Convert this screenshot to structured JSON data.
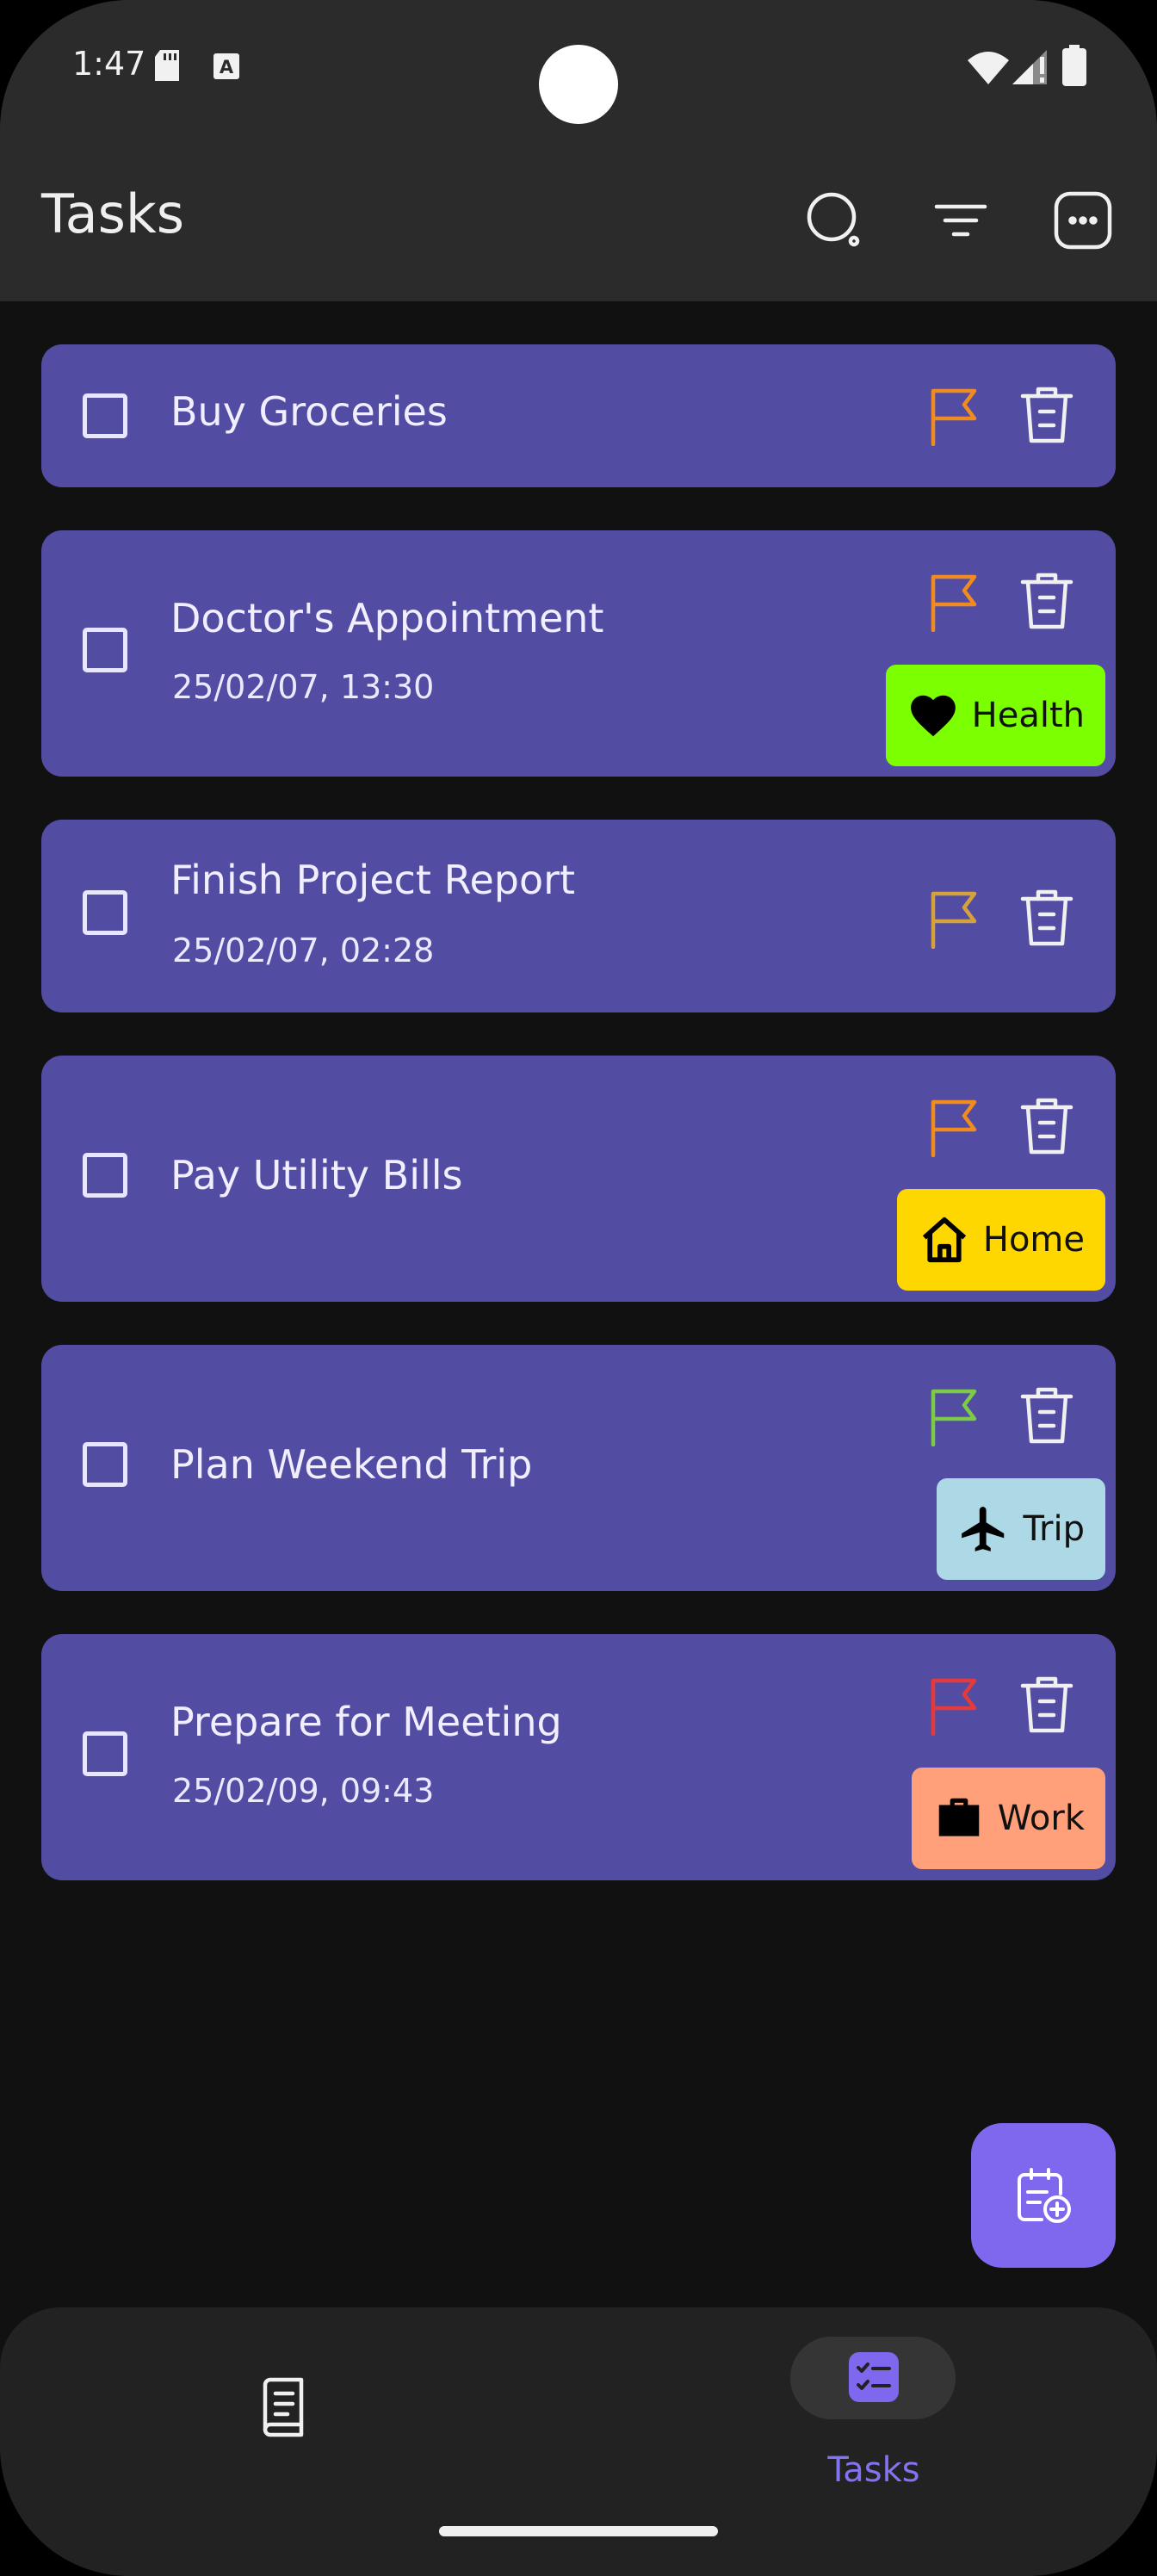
{
  "status_bar": {
    "time": "1:47"
  },
  "app_bar": {
    "title": "Tasks",
    "actions": [
      "search-icon",
      "filter-icon",
      "more-options-icon"
    ]
  },
  "tasks": [
    {
      "title": "Buy Groceries",
      "date": "",
      "flag_color": "#f08b1f",
      "tag": null
    },
    {
      "title": "Doctor's Appointment",
      "date": "25/02/07, 13:30",
      "flag_color": "#f08b1f",
      "tag": {
        "label": "Health",
        "icon": "heart-icon",
        "color": "#7cff00"
      }
    },
    {
      "title": "Finish Project Report",
      "date": "25/02/07, 02:28",
      "flag_color": "#d6a13b",
      "tag": null
    },
    {
      "title": "Pay Utility Bills",
      "date": "",
      "flag_color": "#f08b1f",
      "tag": {
        "label": "Home",
        "icon": "house-icon",
        "color": "#ffd700"
      }
    },
    {
      "title": "Plan Weekend Trip",
      "date": "",
      "flag_color": "#7ccb47",
      "tag": {
        "label": "Trip",
        "icon": "airplane-icon",
        "color": "#add8e6"
      }
    },
    {
      "title": "Prepare for Meeting",
      "date": "25/02/09, 09:43",
      "flag_color": "#e33b3b",
      "tag": {
        "label": "Work",
        "icon": "briefcase-icon",
        "color": "#ffa07a"
      }
    }
  ],
  "fab": {
    "icon": "add-task-icon"
  },
  "bottom_nav": {
    "items": [
      {
        "label": "",
        "icon": "notes-icon",
        "selected": false
      },
      {
        "label": "Tasks",
        "icon": "tasks-icon",
        "selected": true
      }
    ]
  },
  "colors": {
    "background": "#111111",
    "card": "#524ca3",
    "accent": "#7f67ee"
  }
}
